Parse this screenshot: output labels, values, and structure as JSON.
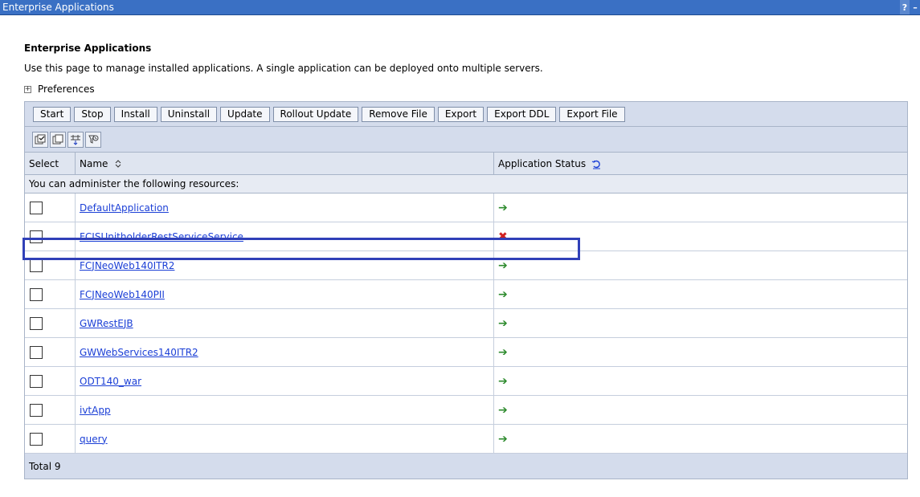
{
  "window": {
    "title": "Enterprise Applications",
    "help_glyph": "?",
    "minimize_glyph": "–"
  },
  "page": {
    "heading": "Enterprise Applications",
    "description": "Use this page to manage installed applications. A single application can be deployed onto multiple servers.",
    "preferences_label": "Preferences"
  },
  "toolbar": {
    "buttons": [
      "Start",
      "Stop",
      "Install",
      "Uninstall",
      "Update",
      "Rollout Update",
      "Remove File",
      "Export",
      "Export DDL",
      "Export File"
    ]
  },
  "icon_toolbar": {
    "icons": [
      "select-all-icon",
      "deselect-all-icon",
      "show-filter-icon",
      "clear-filter-icon"
    ]
  },
  "table": {
    "headers": {
      "select": "Select",
      "name": "Name",
      "status": "Application Status"
    },
    "info_text": "You can administer the following resources:",
    "rows": [
      {
        "name": "DefaultApplication",
        "status": "started"
      },
      {
        "name": "FCISUnitholderRestServiceService",
        "status": "stopped"
      },
      {
        "name": "FCJNeoWeb140ITR2",
        "status": "started"
      },
      {
        "name": "FCJNeoWeb140PII",
        "status": "started"
      },
      {
        "name": "GWRestEJB",
        "status": "started"
      },
      {
        "name": "GWWebServices140ITR2",
        "status": "started"
      },
      {
        "name": "ODT140_war",
        "status": "started"
      },
      {
        "name": "ivtApp",
        "status": "started"
      },
      {
        "name": "query",
        "status": "started"
      }
    ],
    "total_label": "Total 9"
  },
  "colors": {
    "titlebar": "#3a70c4",
    "toolbar_bg": "#d4dcec",
    "link": "#1b3fd6",
    "status_started": "#2e8b2e",
    "status_stopped": "#d02020",
    "highlight_box": "#3040b8"
  }
}
